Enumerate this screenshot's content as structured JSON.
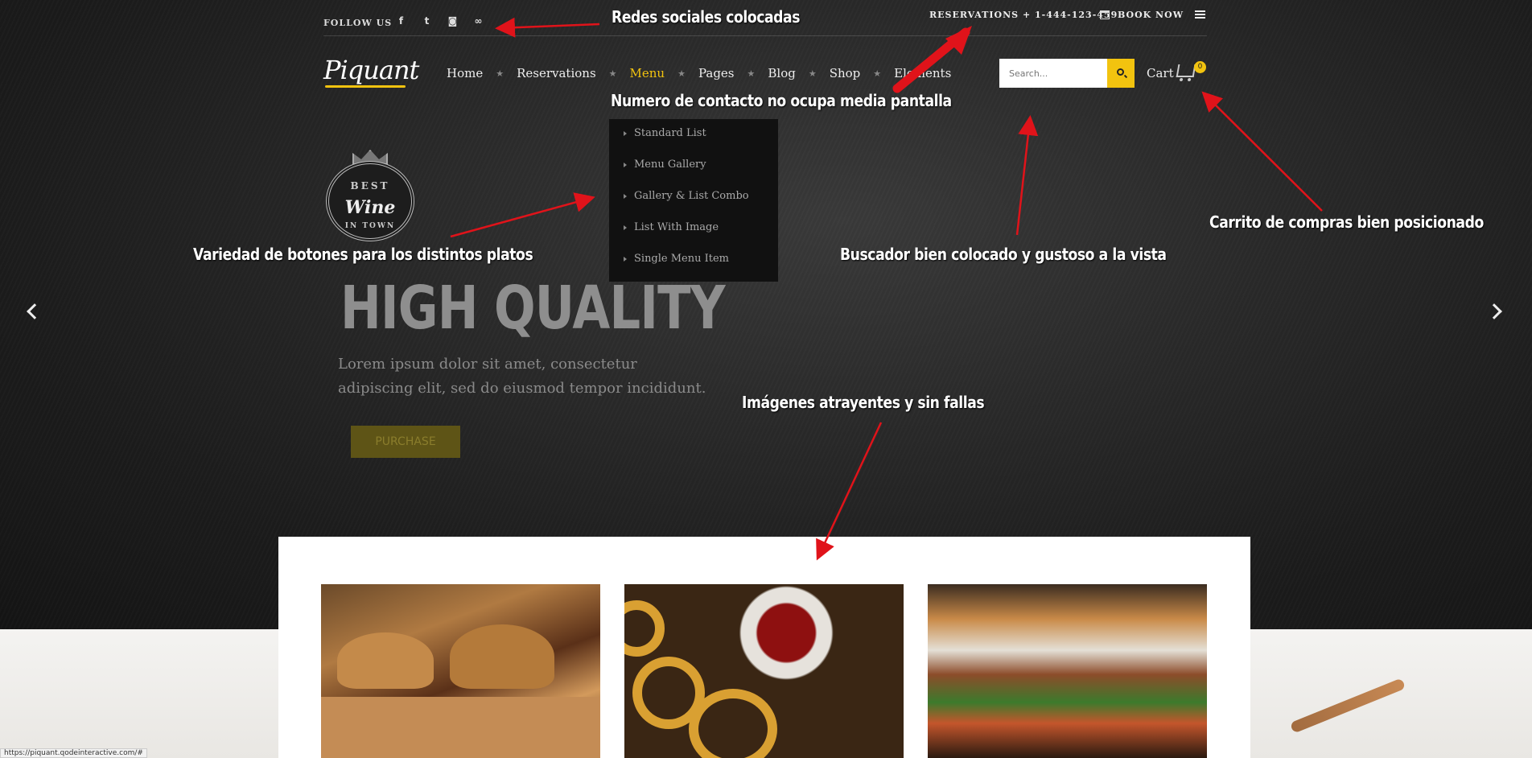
{
  "topbar": {
    "follow_label": "FOLLOW US",
    "socials": [
      {
        "icon": "facebook-icon",
        "glyph": "f"
      },
      {
        "icon": "twitter-icon",
        "glyph": "t"
      },
      {
        "icon": "instagram-icon",
        "glyph": "◙"
      },
      {
        "icon": "tripadvisor-icon",
        "glyph": "∞"
      }
    ],
    "reservations": "RESERVATIONS + 1-444-123-459",
    "book_now": "BOOK NOW"
  },
  "logo": "Piquant",
  "nav": {
    "items": [
      "Home",
      "Reservations",
      "Menu",
      "Pages",
      "Blog",
      "Shop",
      "Elements"
    ],
    "active": "Menu"
  },
  "search": {
    "placeholder": "Search..."
  },
  "cart": {
    "label": "Cart",
    "count": "0"
  },
  "dropdown": {
    "items": [
      "Standard List",
      "Menu Gallery",
      "Gallery & List Combo",
      "List With Image",
      "Single Menu Item"
    ]
  },
  "badge": {
    "top": "BEST",
    "middle": "Wine",
    "bottom": "IN TOWN"
  },
  "hero": {
    "title": "HIGH QUALITY",
    "text": "Lorem ipsum dolor sit amet, consectetur adipiscing elit, sed do eiusmod tempor incididunt.",
    "button": "PURCHASE"
  },
  "status_url": "https://piquant.qodeinteractive.com/#",
  "annotations": {
    "redes": "Redes sociales colocadas",
    "numero": "Numero de contacto no ocupa media pantalla",
    "carrito": "Carrito de compras bien posicionado",
    "variedad": "Variedad de botones para los distintos platos",
    "buscador": "Buscador bien colocado y gustoso a la vista",
    "imagenes": "Imágenes atrayentes y sin fallas"
  },
  "colors": {
    "accent": "#f2c30f",
    "annotation_arrow": "#e0131a"
  }
}
